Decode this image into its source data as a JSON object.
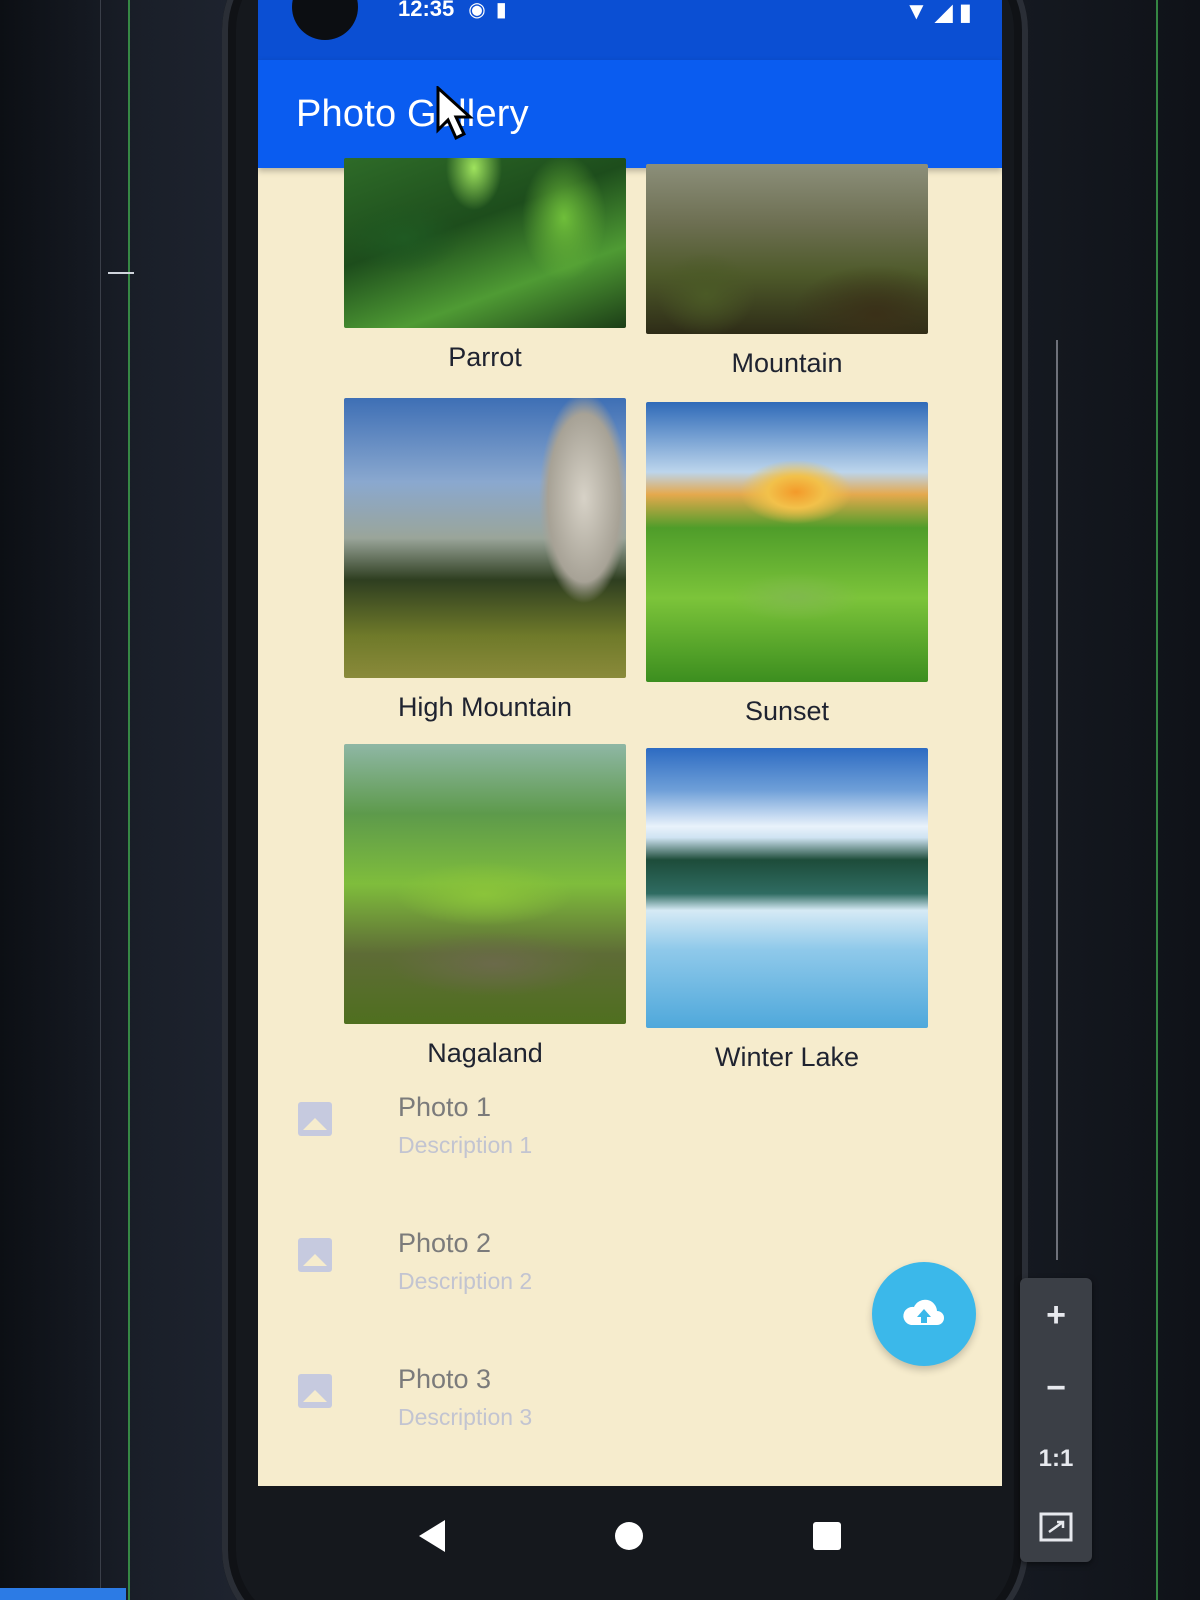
{
  "status_bar": {
    "time": "12:35"
  },
  "app_bar": {
    "title": "Photo Gallery"
  },
  "gallery": [
    {
      "caption": "Parrot"
    },
    {
      "caption": "Mountain"
    },
    {
      "caption": "High Mountain"
    },
    {
      "caption": "Sunset"
    },
    {
      "caption": "Nagaland"
    },
    {
      "caption": "Winter Lake"
    }
  ],
  "list": [
    {
      "title": "Photo 1",
      "description": "Description 1"
    },
    {
      "title": "Photo 2",
      "description": "Description 2"
    },
    {
      "title": "Photo 3",
      "description": "Description 3"
    }
  ],
  "fab": {
    "icon": "cloud-upload-icon",
    "color": "#3bb8ea"
  },
  "emulator_zoom": {
    "zoom_in": "+",
    "zoom_out": "−",
    "ratio": "1:1"
  },
  "colors": {
    "app_bar": "#0a5cf0",
    "status_bar": "#0b4fd3",
    "background": "#f6eccd"
  }
}
